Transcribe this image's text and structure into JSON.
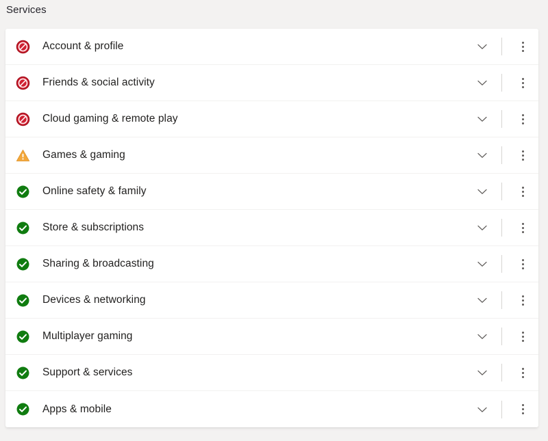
{
  "section": {
    "title": "Services"
  },
  "colors": {
    "page_background": "#f3f2f1",
    "card_background": "#ffffff",
    "text": "#201f1e",
    "blocked_red": "#c8102e",
    "warning_orange": "#f2a33c",
    "ok_green": "#107c10",
    "divider": "#f2f1f0"
  },
  "icons": {
    "blocked": "blocked-icon",
    "warning": "warning-icon",
    "ok": "check-circle-icon",
    "expand": "chevron-down-icon",
    "more": "more-vertical-icon"
  },
  "services": {
    "rows": [
      {
        "label": "Account & profile",
        "status": "blocked"
      },
      {
        "label": "Friends & social activity",
        "status": "blocked"
      },
      {
        "label": "Cloud gaming & remote play",
        "status": "blocked"
      },
      {
        "label": "Games & gaming",
        "status": "warning"
      },
      {
        "label": "Online safety & family",
        "status": "ok"
      },
      {
        "label": "Store & subscriptions",
        "status": "ok"
      },
      {
        "label": "Sharing & broadcasting",
        "status": "ok"
      },
      {
        "label": "Devices & networking",
        "status": "ok"
      },
      {
        "label": "Multiplayer gaming",
        "status": "ok"
      },
      {
        "label": "Support & services",
        "status": "ok"
      },
      {
        "label": "Apps & mobile",
        "status": "ok"
      }
    ]
  }
}
